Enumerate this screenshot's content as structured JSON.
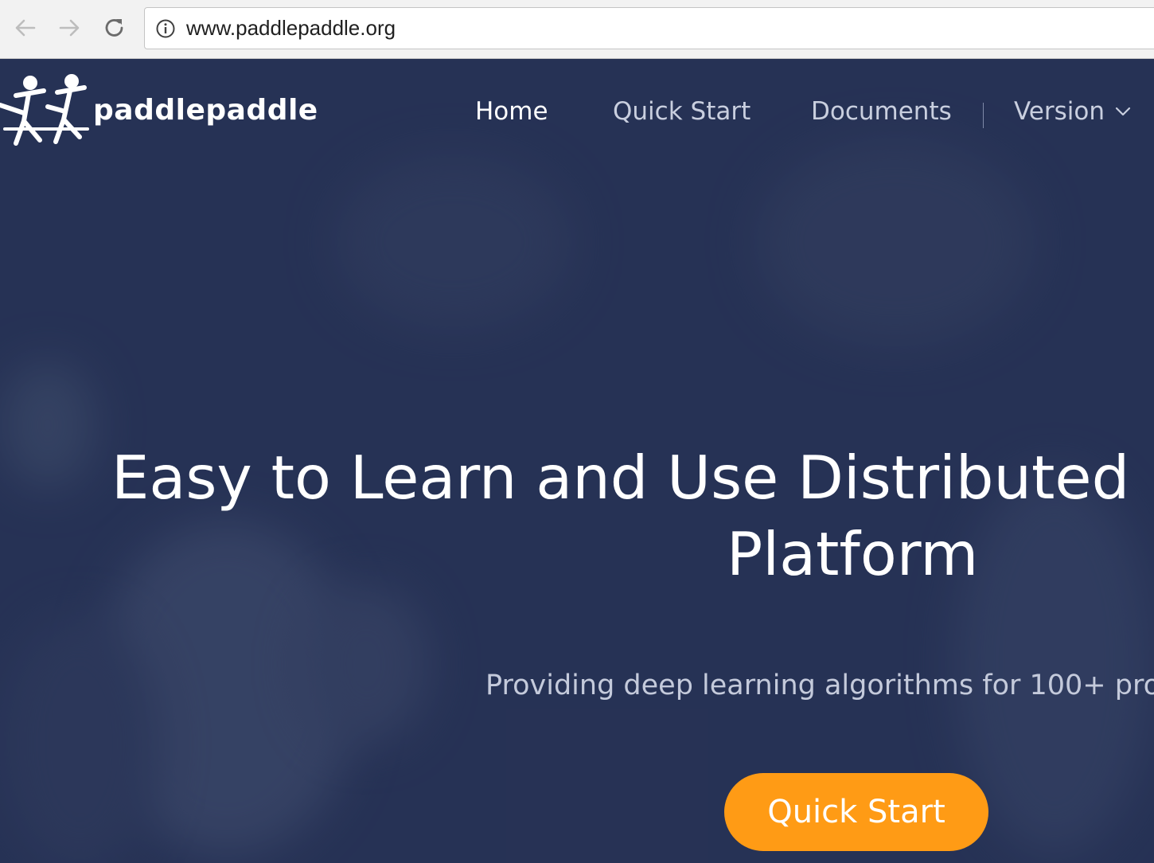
{
  "browser": {
    "url": "www.paddlepaddle.org",
    "icons": [
      "back-arrow-icon",
      "forward-arrow-icon",
      "reload-icon",
      "info-icon"
    ]
  },
  "header": {
    "logo_text": "paddlepaddle",
    "nav": {
      "home": "Home",
      "quick_start": "Quick Start",
      "documents": "Documents",
      "version": "Version"
    }
  },
  "hero": {
    "headline_line1": "Easy to Learn and Use Distributed",
    "headline_line2": "Platform",
    "subline": "Providing deep learning algorithms for 100+ pro",
    "cta_label": "Quick Start"
  },
  "colors": {
    "hero_background": "#2b3656",
    "cta": "#ff9b15",
    "nav_active": "#ffffff",
    "nav_inactive": "#c9cfdf"
  }
}
